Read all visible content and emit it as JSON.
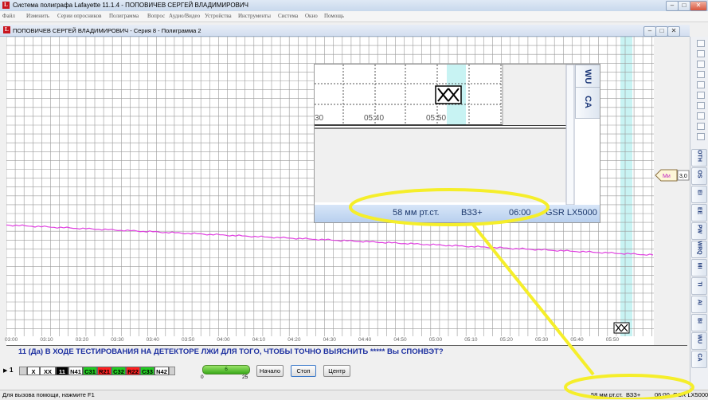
{
  "app": {
    "title": "Система полиграфа Lafayette 11.1.4 - ПОПОВИЧЕВ СЕРГЕЙ ВЛАДИМИРОВИЧ",
    "logo": "L"
  },
  "menu": [
    "Файл",
    "Изменить",
    "Серии опросников",
    "Полиграмма",
    "Вопрос",
    "Аудио/Видео",
    "Устройства",
    "Инструменты",
    "Система",
    "Окно",
    "Помощь"
  ],
  "child_window": {
    "title": "ПОПОВИЧЕВ СЕРГЕЙ ВЛАДИМИРОВИЧ - Серия 8 - Полиграмма 2"
  },
  "chart": {
    "x_ticks": [
      "03:00",
      "03:10",
      "03:20",
      "03:30",
      "03:40",
      "03:50",
      "04:00",
      "04:10",
      "04:20",
      "04:30",
      "04:40",
      "04:50",
      "05:00",
      "05:10",
      "05:20",
      "05:30",
      "05:40",
      "05:50"
    ],
    "trace_color": "#e040e0",
    "grid_color": "#9a9a9a",
    "highlight_color": "#c8f3f3"
  },
  "right_tabs": [
    "OTH",
    "OS",
    "EI",
    "EE",
    "PW",
    "WRQ",
    "MI",
    "TI",
    "AI",
    "BI",
    "WU",
    "CA"
  ],
  "marker": {
    "label": "Ми",
    "value": "3,0"
  },
  "question": {
    "text": "11 (Да) В ХОДЕ ТЕСТИРОВАНИЯ НА ДЕТЕКТОРЕ ЛЖИ ДЛЯ ТОГО, ЧТОБЫ ТОЧНО ВЫЯСНИТЬ ***** Вы СПОНВЭТ?"
  },
  "sequence": {
    "current": "1",
    "items": [
      {
        "label": "X",
        "bg": "#ffffff",
        "fg": "#000000"
      },
      {
        "label": "XX",
        "bg": "#ffffff",
        "fg": "#000000"
      },
      {
        "label": "11",
        "bg": "#000000",
        "fg": "#ffffff"
      },
      {
        "label": "N41",
        "bg": "#ffffff",
        "fg": "#000000"
      },
      {
        "label": "C31",
        "bg": "#22cc22",
        "fg": "#000000"
      },
      {
        "label": "R21",
        "bg": "#ff2020",
        "fg": "#000000"
      },
      {
        "label": "C32",
        "bg": "#22cc22",
        "fg": "#000000"
      },
      {
        "label": "R22",
        "bg": "#ff2020",
        "fg": "#000000"
      },
      {
        "label": "C33",
        "bg": "#22cc22",
        "fg": "#000000"
      },
      {
        "label": "N42",
        "bg": "#ffffff",
        "fg": "#000000"
      }
    ]
  },
  "progress": {
    "value": "6",
    "min": "0",
    "max": "25"
  },
  "buttons": {
    "start": "Начало",
    "stop": "Стоп",
    "center": "Центр"
  },
  "status": {
    "help": "Для вызова помощи, нажмите F1",
    "pressure": "58 мм рт.ст.",
    "mode": "ВЗЗ+",
    "time": "06:00",
    "device": "GSR LX5000"
  },
  "zoom": {
    "x_ticks": [
      "30",
      "05:40",
      "05:50"
    ],
    "tabs": [
      "WU",
      "CA"
    ],
    "pressure": "58 мм рт.ст.",
    "mode": "ВЗЗ+",
    "time": "06:00",
    "device": "GSR LX5000"
  }
}
